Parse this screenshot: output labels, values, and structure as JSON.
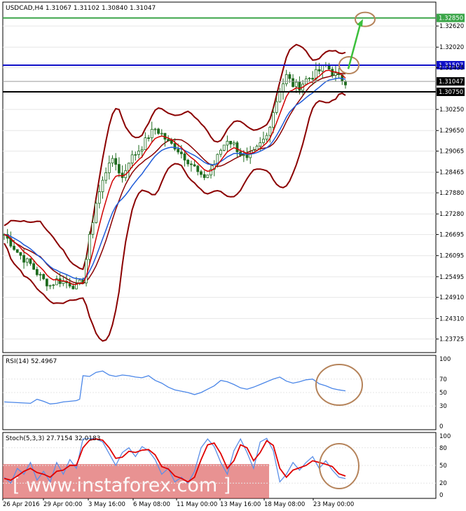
{
  "colors": {
    "background": "#ffffff",
    "frame": "#000000",
    "grid": "#e6e6e6",
    "candle": "#1e6b1e",
    "ema_fast": "#d00000",
    "ema_slow": "#1e5bd8",
    "bollinger": "#8b0000",
    "green_level": "#3aa548",
    "blue_level": "#1010c8",
    "black_level": "#000000",
    "rsi_line": "#4a86e8",
    "stoch_main": "#5b8fe8",
    "stoch_signal": "#e00000",
    "annotation": "#b5835a",
    "arrow": "#3cc03c",
    "watermark": "#d84a4a"
  },
  "chart_data": [
    {
      "type": "candlestick",
      "title": "USDCAD,H4  1.31067 1.31102 1.30840 1.31047",
      "ylim": [
        1.234,
        1.332
      ],
      "x_labels": [
        "26 Apr 2016",
        "29 Apr 00:00",
        "3 May 16:00",
        "6 May 08:00",
        "11 May 00:00",
        "13 May 16:00",
        "18 May 08:00",
        "23 May 00:00"
      ],
      "y_ticks": [
        "1.32620",
        "1.32020",
        "1.31435",
        "1.30250",
        "1.29650",
        "1.29065",
        "1.28465",
        "1.27880",
        "1.27280",
        "1.26695",
        "1.26095",
        "1.25495",
        "1.24910",
        "1.24310",
        "1.23725"
      ],
      "y_tick_values": [
        1.3262,
        1.3202,
        1.31435,
        1.3025,
        1.2965,
        1.29065,
        1.28465,
        1.2788,
        1.2728,
        1.26695,
        1.26095,
        1.25495,
        1.2491,
        1.2431,
        1.23725
      ],
      "levels": [
        {
          "label": "1.32850",
          "value": 1.3285,
          "color": "green_level"
        },
        {
          "label": "1.31507",
          "value": 1.31507,
          "color": "blue_level"
        },
        {
          "label": "1.31047",
          "value": 1.31047,
          "color": "current"
        },
        {
          "label": "1.30750",
          "value": 1.3075,
          "color": "black_level"
        }
      ],
      "close_path": [
        [
          0,
          1.267
        ],
        [
          2,
          1.2645
        ],
        [
          4,
          1.262
        ],
        [
          6,
          1.26
        ],
        [
          8,
          1.2585
        ],
        [
          10,
          1.256
        ],
        [
          12,
          1.254
        ],
        [
          14,
          1.2525
        ],
        [
          16,
          1.254
        ],
        [
          18,
          1.2535
        ],
        [
          20,
          1.253
        ],
        [
          22,
          1.252
        ],
        [
          24,
          1.254
        ],
        [
          26,
          1.266
        ],
        [
          28,
          1.276
        ],
        [
          30,
          1.282
        ],
        [
          32,
          1.288
        ],
        [
          34,
          1.287
        ],
        [
          36,
          1.283
        ],
        [
          38,
          1.288
        ],
        [
          40,
          1.29
        ],
        [
          42,
          1.292
        ],
        [
          44,
          1.295
        ],
        [
          46,
          1.297
        ],
        [
          48,
          1.2955
        ],
        [
          50,
          1.293
        ],
        [
          52,
          1.292
        ],
        [
          54,
          1.29
        ],
        [
          56,
          1.288
        ],
        [
          58,
          1.286
        ],
        [
          60,
          1.283
        ],
        [
          62,
          1.284
        ],
        [
          64,
          1.287
        ],
        [
          66,
          1.291
        ],
        [
          68,
          1.294
        ],
        [
          70,
          1.2925
        ],
        [
          72,
          1.29
        ],
        [
          74,
          1.288
        ],
        [
          76,
          1.29
        ],
        [
          78,
          1.2925
        ],
        [
          80,
          1.295
        ],
        [
          82,
          1.302
        ],
        [
          84,
          1.308
        ],
        [
          86,
          1.312
        ],
        [
          88,
          1.3095
        ],
        [
          90,
          1.309
        ],
        [
          92,
          1.311
        ],
        [
          94,
          1.312
        ],
        [
          96,
          1.3135
        ],
        [
          98,
          1.315
        ],
        [
          100,
          1.313
        ],
        [
          102,
          1.3115
        ],
        [
          104,
          1.3105
        ]
      ],
      "series": [
        {
          "name": "",
          "role": "ema_fast"
        },
        {
          "name": "",
          "role": "ema_slow"
        },
        {
          "name": "",
          "role": "bollinger"
        }
      ],
      "annotations": [
        "circle at 1.32850 target",
        "circle at 1.31507 resistance",
        "arrow up to 1.32850"
      ]
    },
    {
      "type": "line",
      "title": "RSI(14) 52.4967",
      "ylim": [
        0,
        100
      ],
      "y_ticks": [
        "100",
        "70",
        "50",
        "30",
        "0"
      ],
      "y_tick_values": [
        100,
        70,
        50,
        30,
        0
      ],
      "points": [
        [
          0,
          36
        ],
        [
          4,
          35
        ],
        [
          8,
          34
        ],
        [
          10,
          40
        ],
        [
          12,
          37
        ],
        [
          14,
          33
        ],
        [
          16,
          34
        ],
        [
          18,
          36
        ],
        [
          20,
          37
        ],
        [
          22,
          38
        ],
        [
          23,
          40
        ],
        [
          24,
          75
        ],
        [
          26,
          74
        ],
        [
          28,
          80
        ],
        [
          30,
          82
        ],
        [
          32,
          76
        ],
        [
          34,
          74
        ],
        [
          36,
          76
        ],
        [
          38,
          75
        ],
        [
          40,
          73
        ],
        [
          42,
          72
        ],
        [
          44,
          75
        ],
        [
          46,
          68
        ],
        [
          48,
          64
        ],
        [
          50,
          58
        ],
        [
          52,
          54
        ],
        [
          54,
          52
        ],
        [
          56,
          50
        ],
        [
          58,
          47
        ],
        [
          60,
          50
        ],
        [
          62,
          55
        ],
        [
          64,
          60
        ],
        [
          66,
          68
        ],
        [
          68,
          66
        ],
        [
          70,
          62
        ],
        [
          72,
          57
        ],
        [
          74,
          55
        ],
        [
          76,
          58
        ],
        [
          78,
          62
        ],
        [
          80,
          66
        ],
        [
          82,
          70
        ],
        [
          84,
          73
        ],
        [
          86,
          67
        ],
        [
          88,
          64
        ],
        [
          90,
          66
        ],
        [
          92,
          69
        ],
        [
          94,
          70
        ],
        [
          96,
          63
        ],
        [
          98,
          60
        ],
        [
          100,
          56
        ],
        [
          102,
          54
        ],
        [
          104,
          52.5
        ]
      ]
    },
    {
      "type": "line",
      "title": "Stoch(5,3,3) 27.7154 32.0183",
      "ylim": [
        0,
        100
      ],
      "y_ticks": [
        "100",
        "80",
        "50",
        "20",
        "0"
      ],
      "y_tick_values": [
        100,
        80,
        50,
        20,
        0
      ],
      "series": [
        {
          "name": "",
          "role": "stoch_main",
          "points": [
            [
              0,
              30
            ],
            [
              2,
              20
            ],
            [
              4,
              45
            ],
            [
              6,
              35
            ],
            [
              8,
              55
            ],
            [
              10,
              25
            ],
            [
              12,
              40
            ],
            [
              14,
              22
            ],
            [
              16,
              55
            ],
            [
              18,
              35
            ],
            [
              20,
              60
            ],
            [
              22,
              45
            ],
            [
              24,
              95
            ],
            [
              26,
              96
            ],
            [
              28,
              95
            ],
            [
              30,
              90
            ],
            [
              32,
              70
            ],
            [
              34,
              50
            ],
            [
              36,
              72
            ],
            [
              38,
              80
            ],
            [
              40,
              65
            ],
            [
              42,
              82
            ],
            [
              44,
              75
            ],
            [
              46,
              60
            ],
            [
              48,
              35
            ],
            [
              50,
              45
            ],
            [
              52,
              22
            ],
            [
              54,
              30
            ],
            [
              56,
              20
            ],
            [
              58,
              40
            ],
            [
              60,
              80
            ],
            [
              62,
              95
            ],
            [
              64,
              82
            ],
            [
              66,
              55
            ],
            [
              68,
              35
            ],
            [
              70,
              75
            ],
            [
              72,
              95
            ],
            [
              74,
              72
            ],
            [
              76,
              45
            ],
            [
              78,
              90
            ],
            [
              80,
              96
            ],
            [
              82,
              75
            ],
            [
              84,
              22
            ],
            [
              86,
              35
            ],
            [
              88,
              55
            ],
            [
              90,
              42
            ],
            [
              92,
              55
            ],
            [
              94,
              65
            ],
            [
              96,
              45
            ],
            [
              98,
              58
            ],
            [
              100,
              42
            ],
            [
              102,
              30
            ],
            [
              104,
              27.7
            ]
          ]
        },
        {
          "name": "",
          "role": "stoch_signal",
          "points": [
            [
              0,
              28
            ],
            [
              2,
              25
            ],
            [
              4,
              32
            ],
            [
              6,
              40
            ],
            [
              8,
              45
            ],
            [
              10,
              38
            ],
            [
              12,
              35
            ],
            [
              14,
              30
            ],
            [
              16,
              40
            ],
            [
              18,
              42
            ],
            [
              20,
              50
            ],
            [
              22,
              50
            ],
            [
              24,
              80
            ],
            [
              26,
              93
            ],
            [
              28,
              95
            ],
            [
              30,
              93
            ],
            [
              32,
              80
            ],
            [
              34,
              62
            ],
            [
              36,
              64
            ],
            [
              38,
              74
            ],
            [
              40,
              72
            ],
            [
              42,
              76
            ],
            [
              44,
              77
            ],
            [
              46,
              68
            ],
            [
              48,
              48
            ],
            [
              50,
              44
            ],
            [
              52,
              32
            ],
            [
              54,
              28
            ],
            [
              56,
              22
            ],
            [
              58,
              30
            ],
            [
              60,
              60
            ],
            [
              62,
              85
            ],
            [
              64,
              88
            ],
            [
              66,
              70
            ],
            [
              68,
              45
            ],
            [
              70,
              58
            ],
            [
              72,
              85
            ],
            [
              74,
              80
            ],
            [
              76,
              58
            ],
            [
              78,
              72
            ],
            [
              80,
              92
            ],
            [
              82,
              84
            ],
            [
              84,
              45
            ],
            [
              86,
              30
            ],
            [
              88,
              42
            ],
            [
              90,
              46
            ],
            [
              92,
              50
            ],
            [
              94,
              58
            ],
            [
              96,
              55
            ],
            [
              98,
              52
            ],
            [
              100,
              48
            ],
            [
              102,
              36
            ],
            [
              104,
              32.0
            ]
          ]
        }
      ]
    }
  ],
  "watermark": "[ www.instaforex.com ]"
}
